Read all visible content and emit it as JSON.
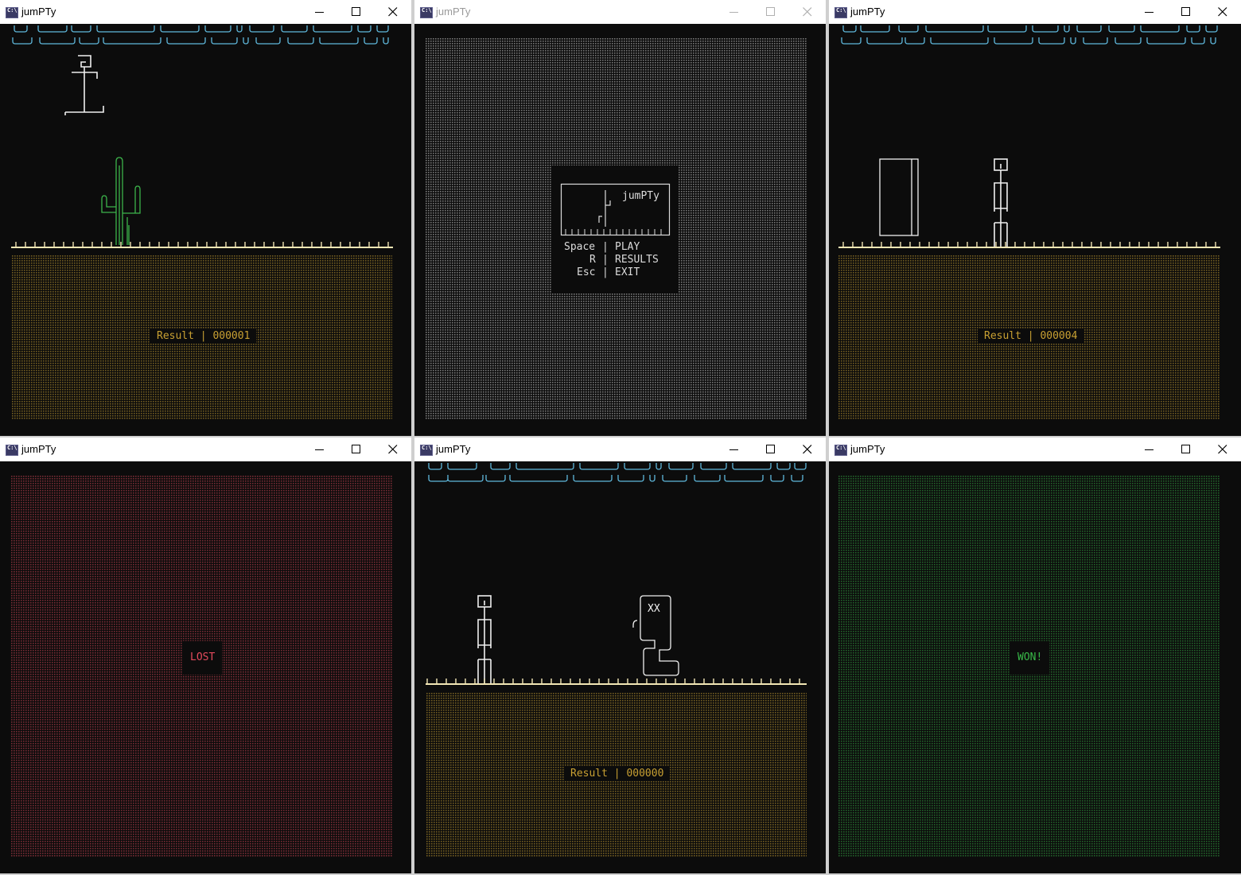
{
  "app": {
    "title": "jumPTy"
  },
  "window_controls": [
    "minimize-icon",
    "maximize-icon",
    "close-icon"
  ],
  "colors": {
    "background": "#0c0c0c",
    "cloud": "#5fb8dc",
    "ground": "#f2e6b4",
    "dirt_dots": "#c8a032",
    "menu_dots": "#bfbfbf",
    "lost_dots": "#e34a5c",
    "won_dots": "#38b848",
    "cactus": "#3cb44b",
    "sprite": "#f0f0f0",
    "result_text": "#c8a032"
  },
  "windows": [
    {
      "state": "playing",
      "obstacle": "cactus",
      "result": {
        "label": "Result",
        "sep": "|",
        "value": "000001"
      }
    },
    {
      "state": "menu",
      "menu": {
        "logo_text": "jumPTy",
        "items": [
          {
            "key": "Space",
            "sep": "|",
            "action": "PLAY"
          },
          {
            "key": "R",
            "sep": "|",
            "action": "RESULTS"
          },
          {
            "key": "Esc",
            "sep": "|",
            "action": "EXIT"
          }
        ]
      }
    },
    {
      "state": "playing",
      "obstacle": "block",
      "result": {
        "label": "Result",
        "sep": "|",
        "value": "000004"
      }
    },
    {
      "state": "lost",
      "message": "LOST"
    },
    {
      "state": "playing",
      "obstacle": "snake",
      "snake_eyes": "XX",
      "result": {
        "label": "Result",
        "sep": "|",
        "value": "000000"
      }
    },
    {
      "state": "won",
      "message": "WON!"
    }
  ]
}
